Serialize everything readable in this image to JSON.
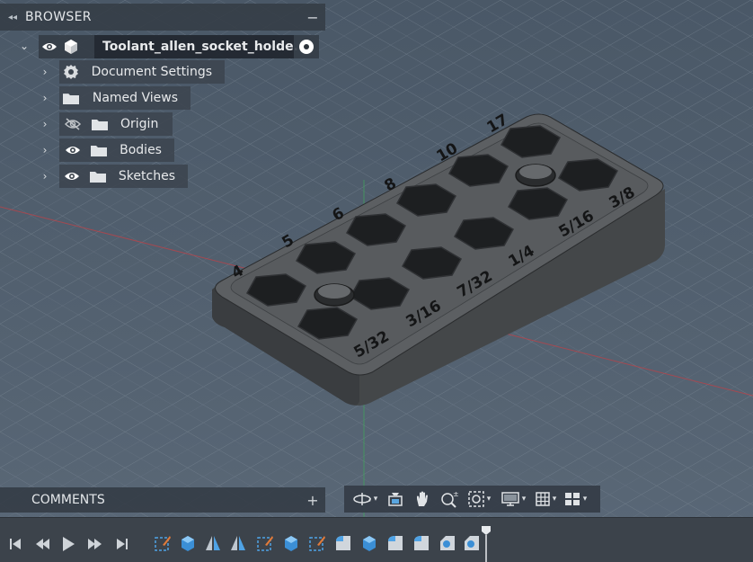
{
  "browser": {
    "title": "BROWSER",
    "collapse_icon": "double-chevron-left-icon",
    "minimize_icon": "minus-icon",
    "root": {
      "label": "Toolant_allen_socket_holde...",
      "icon": "component-cube-icon",
      "visibility_icon": "eye-icon",
      "expanded": true
    },
    "items": [
      {
        "label": "Document Settings",
        "icon": "gear-icon",
        "visibility": null
      },
      {
        "label": "Named Views",
        "icon": "folder-icon",
        "visibility": null
      },
      {
        "label": "Origin",
        "icon": "folder-icon",
        "visibility": "eye-hidden-icon"
      },
      {
        "label": "Bodies",
        "icon": "folder-icon",
        "visibility": "eye-icon"
      },
      {
        "label": "Sketches",
        "icon": "folder-icon",
        "visibility": "eye-icon"
      }
    ]
  },
  "comments": {
    "title": "COMMENTS",
    "add_icon": "plus-icon"
  },
  "model_labels": {
    "top_row": [
      "4",
      "5",
      "6",
      "8",
      "10",
      "17"
    ],
    "bottom_row": [
      "5/32",
      "3/16",
      "7/32",
      "1/4",
      "5/16",
      "3/8"
    ]
  },
  "navbar": {
    "tools": [
      "orbit-icon",
      "look-at-icon",
      "pan-hand-icon",
      "zoom-icon",
      "fit-window-icon",
      "display-settings-icon",
      "grid-icon",
      "viewports-icon"
    ]
  },
  "timeline": {
    "controls": [
      "go-to-start-icon",
      "step-back-icon",
      "play-icon",
      "step-forward-icon",
      "go-to-end-icon"
    ],
    "features": [
      "sketch-icon",
      "extrude-icon",
      "mirror-icon",
      "mirror-icon",
      "sketch-icon",
      "extrude-icon",
      "sketch-icon",
      "fillet-icon",
      "extrude-icon",
      "fillet-icon",
      "fillet-icon",
      "chamfer-icon",
      "chamfer-icon"
    ]
  },
  "colors": {
    "background": "#4f5f6f",
    "panel": "#3c444e",
    "model": "#5b5e61"
  }
}
